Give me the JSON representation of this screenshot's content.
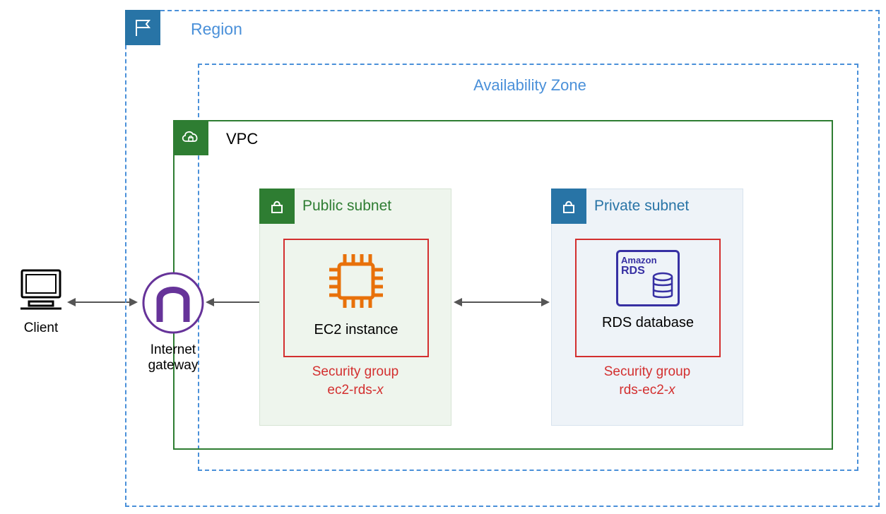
{
  "client": {
    "label": "Client"
  },
  "igw": {
    "label1": "Internet",
    "label2": "gateway"
  },
  "region": {
    "label": "Region"
  },
  "az": {
    "label": "Availability Zone"
  },
  "vpc": {
    "label": "VPC"
  },
  "publicSubnet": {
    "label": "Public subnet",
    "resource": "EC2 instance",
    "sg1": "Security group",
    "sg2a": "ec2-rds-",
    "sg2b": "x"
  },
  "privateSubnet": {
    "label": "Private subnet",
    "rdsTop": "Amazon",
    "rdsBottom": "RDS",
    "resource": "RDS database",
    "sg1": "Security group",
    "sg2a": "rds-ec2-",
    "sg2b": "x"
  },
  "colors": {
    "blue": "#4a90d9",
    "green": "#2e7d32",
    "red": "#d32f2f",
    "purple": "#663399",
    "orange": "#e8710a",
    "indigo": "#3730a3"
  }
}
